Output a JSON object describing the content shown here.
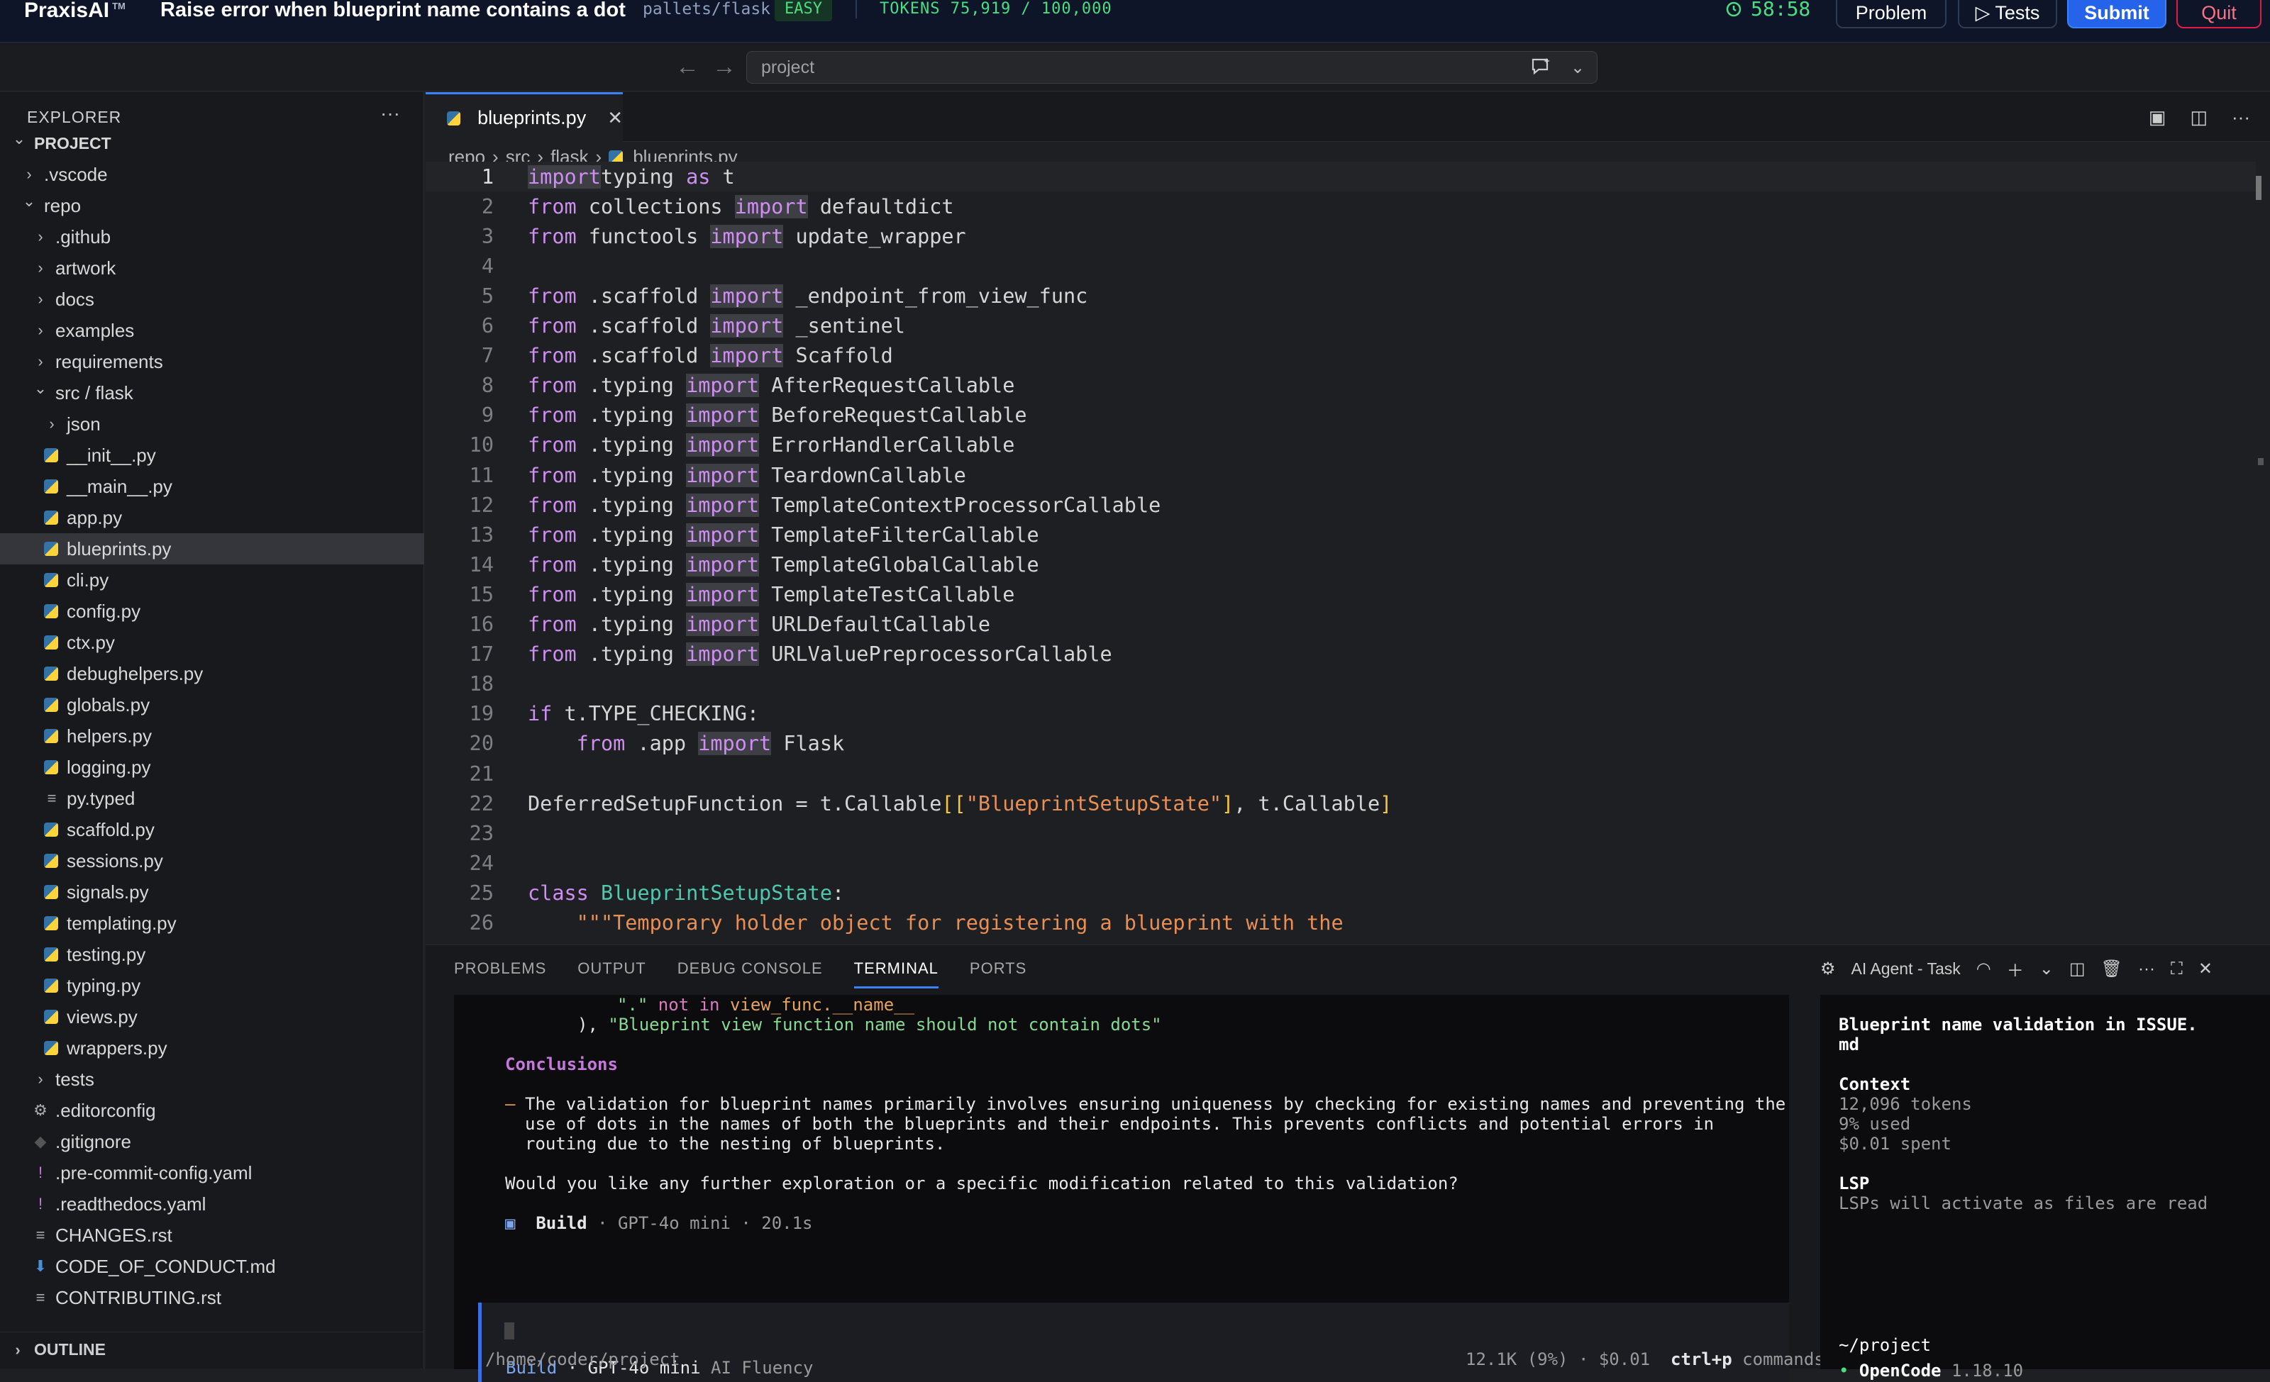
{
  "topbar": {
    "brand": "PraxisAI",
    "brand_tm": "TM",
    "task_title": "Raise error when blueprint name contains a dot",
    "repo": "pallets/flask",
    "difficulty": "EASY",
    "tokens": "TOKENS 75,919 / 100,000",
    "timer": "58:58",
    "problem_label": "Problem",
    "tests_label": "▷ Tests",
    "submit_label": "Submit",
    "quit_label": "Quit"
  },
  "command_bar": {
    "placeholder": "project"
  },
  "sidebar": {
    "title": "EXPLORER",
    "items": [
      {
        "label": "PROJECT",
        "kind": "root",
        "depth": 0,
        "open": true
      },
      {
        "label": ".vscode",
        "kind": "folder",
        "depth": 1,
        "open": false
      },
      {
        "label": "repo",
        "kind": "folder",
        "depth": 1,
        "open": true
      },
      {
        "label": ".github",
        "kind": "folder",
        "depth": 2,
        "open": false
      },
      {
        "label": "artwork",
        "kind": "folder",
        "depth": 2,
        "open": false
      },
      {
        "label": "docs",
        "kind": "folder",
        "depth": 2,
        "open": false
      },
      {
        "label": "examples",
        "kind": "folder",
        "depth": 2,
        "open": false
      },
      {
        "label": "requirements",
        "kind": "folder",
        "depth": 2,
        "open": false
      },
      {
        "label": "src / flask",
        "kind": "folder",
        "depth": 2,
        "open": true
      },
      {
        "label": "json",
        "kind": "folder",
        "depth": 3,
        "open": false
      },
      {
        "label": "__init__.py",
        "kind": "py",
        "depth": 3
      },
      {
        "label": "__main__.py",
        "kind": "py",
        "depth": 3
      },
      {
        "label": "app.py",
        "kind": "py",
        "depth": 3
      },
      {
        "label": "blueprints.py",
        "kind": "py",
        "depth": 3,
        "active": true
      },
      {
        "label": "cli.py",
        "kind": "py",
        "depth": 3
      },
      {
        "label": "config.py",
        "kind": "py",
        "depth": 3
      },
      {
        "label": "ctx.py",
        "kind": "py",
        "depth": 3
      },
      {
        "label": "debughelpers.py",
        "kind": "py",
        "depth": 3
      },
      {
        "label": "globals.py",
        "kind": "py",
        "depth": 3
      },
      {
        "label": "helpers.py",
        "kind": "py",
        "depth": 3
      },
      {
        "label": "logging.py",
        "kind": "py",
        "depth": 3
      },
      {
        "label": "py.typed",
        "kind": "text",
        "depth": 3
      },
      {
        "label": "scaffold.py",
        "kind": "py",
        "depth": 3
      },
      {
        "label": "sessions.py",
        "kind": "py",
        "depth": 3
      },
      {
        "label": "signals.py",
        "kind": "py",
        "depth": 3
      },
      {
        "label": "templating.py",
        "kind": "py",
        "depth": 3
      },
      {
        "label": "testing.py",
        "kind": "py",
        "depth": 3
      },
      {
        "label": "typing.py",
        "kind": "py",
        "depth": 3
      },
      {
        "label": "views.py",
        "kind": "py",
        "depth": 3
      },
      {
        "label": "wrappers.py",
        "kind": "py",
        "depth": 3
      },
      {
        "label": "tests",
        "kind": "folder",
        "depth": 2,
        "open": false
      },
      {
        "label": ".editorconfig",
        "kind": "gear",
        "depth": 2
      },
      {
        "label": ".gitignore",
        "kind": "git",
        "depth": 2
      },
      {
        "label": ".pre-commit-config.yaml",
        "kind": "yaml",
        "depth": 2
      },
      {
        "label": ".readthedocs.yaml",
        "kind": "yaml",
        "depth": 2
      },
      {
        "label": "CHANGES.rst",
        "kind": "text",
        "depth": 2
      },
      {
        "label": "CODE_OF_CONDUCT.md",
        "kind": "md",
        "depth": 2
      },
      {
        "label": "CONTRIBUTING.rst",
        "kind": "text",
        "depth": 2
      }
    ],
    "outline_label": "OUTLINE"
  },
  "editor": {
    "tab_label": "blueprints.py",
    "breadcrumb": [
      "repo",
      "src",
      "flask",
      "blueprints.py"
    ],
    "current_line": 1,
    "lines": [
      [
        [
          "kwi",
          "import"
        ],
        [
          "",
          "typing "
        ],
        [
          "kw",
          "as"
        ],
        [
          "",
          " t"
        ]
      ],
      [
        [
          "kw",
          "from"
        ],
        [
          "",
          " collections "
        ],
        [
          "kwi",
          "import"
        ],
        [
          "",
          " defaultdict"
        ]
      ],
      [
        [
          "kw",
          "from"
        ],
        [
          "",
          " functools "
        ],
        [
          "kwi",
          "import"
        ],
        [
          "",
          " update_wrapper"
        ]
      ],
      [],
      [
        [
          "kw",
          "from"
        ],
        [
          "",
          " .scaffold "
        ],
        [
          "kwi",
          "import"
        ],
        [
          "",
          " _endpoint_from_view_func"
        ]
      ],
      [
        [
          "kw",
          "from"
        ],
        [
          "",
          " .scaffold "
        ],
        [
          "kwi",
          "import"
        ],
        [
          "",
          " _sentinel"
        ]
      ],
      [
        [
          "kw",
          "from"
        ],
        [
          "",
          " .scaffold "
        ],
        [
          "kwi",
          "import"
        ],
        [
          "",
          " Scaffold"
        ]
      ],
      [
        [
          "kw",
          "from"
        ],
        [
          "",
          " .typing "
        ],
        [
          "kwi",
          "import"
        ],
        [
          "",
          " AfterRequestCallable"
        ]
      ],
      [
        [
          "kw",
          "from"
        ],
        [
          "",
          " .typing "
        ],
        [
          "kwi",
          "import"
        ],
        [
          "",
          " BeforeRequestCallable"
        ]
      ],
      [
        [
          "kw",
          "from"
        ],
        [
          "",
          " .typing "
        ],
        [
          "kwi",
          "import"
        ],
        [
          "",
          " ErrorHandlerCallable"
        ]
      ],
      [
        [
          "kw",
          "from"
        ],
        [
          "",
          " .typing "
        ],
        [
          "kwi",
          "import"
        ],
        [
          "",
          " TeardownCallable"
        ]
      ],
      [
        [
          "kw",
          "from"
        ],
        [
          "",
          " .typing "
        ],
        [
          "kwi",
          "import"
        ],
        [
          "",
          " TemplateContextProcessorCallable"
        ]
      ],
      [
        [
          "kw",
          "from"
        ],
        [
          "",
          " .typing "
        ],
        [
          "kwi",
          "import"
        ],
        [
          "",
          " TemplateFilterCallable"
        ]
      ],
      [
        [
          "kw",
          "from"
        ],
        [
          "",
          " .typing "
        ],
        [
          "kwi",
          "import"
        ],
        [
          "",
          " TemplateGlobalCallable"
        ]
      ],
      [
        [
          "kw",
          "from"
        ],
        [
          "",
          " .typing "
        ],
        [
          "kwi",
          "import"
        ],
        [
          "",
          " TemplateTestCallable"
        ]
      ],
      [
        [
          "kw",
          "from"
        ],
        [
          "",
          " .typing "
        ],
        [
          "kwi",
          "import"
        ],
        [
          "",
          " URLDefaultCallable"
        ]
      ],
      [
        [
          "kw",
          "from"
        ],
        [
          "",
          " .typing "
        ],
        [
          "kwi",
          "import"
        ],
        [
          "",
          " URLValuePreprocessorCallable"
        ]
      ],
      [],
      [
        [
          "kw",
          "if"
        ],
        [
          "",
          " t.TYPE_CHECKING:"
        ]
      ],
      [
        [
          "",
          "    "
        ],
        [
          "kw",
          "from"
        ],
        [
          "",
          " .app "
        ],
        [
          "kwi",
          "import"
        ],
        [
          "",
          " Flask"
        ]
      ],
      [],
      [
        [
          "",
          "DeferredSetupFunction = t.Callable"
        ],
        [
          "brk",
          "[["
        ],
        [
          "str",
          "\"BlueprintSetupState\""
        ],
        [
          "brk",
          "]"
        ],
        [
          "",
          ", t.Callable"
        ],
        [
          "brk",
          "]"
        ]
      ],
      [],
      [],
      [
        [
          "kw",
          "class"
        ],
        [
          "",
          " "
        ],
        [
          "cls",
          "BlueprintSetupState"
        ],
        [
          "",
          ":"
        ]
      ],
      [
        [
          "",
          "    "
        ],
        [
          "str",
          "\"\"\"Temporary holder object for registering a blueprint with the"
        ]
      ]
    ]
  },
  "panel": {
    "tabs": [
      "PROBLEMS",
      "OUTPUT",
      "DEBUG CONSOLE",
      "TERMINAL",
      "PORTS"
    ],
    "active_tab": "TERMINAL",
    "terminal_name": "AI Agent - Task"
  },
  "terminal": {
    "code_line1_a": "\".\"",
    "code_line1_b": " not in ",
    "code_line1_c": "view_func.__name__",
    "code_line2_a": "), ",
    "code_line2_b": "\"Blueprint view function name should not contain dots\"",
    "conclusions_heading": "Conclusions",
    "bullet_dash": "–",
    "bullet_l1": "The validation for blueprint names primarily involves ensuring uniqueness by checking for existing names and preventing the",
    "bullet_l2": "use of dots in the names of both the blueprints and their endpoints. This prevents conflicts and potential errors in",
    "bullet_l3": "routing due to the nesting of blueprints.",
    "question": "Would you like any further exploration or a specific modification related to this validation?",
    "status_icon": "▣",
    "status_mode": "Build",
    "status_meta": "· GPT-4o mini · 20.1s",
    "input_mode": "Build",
    "input_model": "· GPT-4o mini",
    "input_extra": "AI Fluency",
    "footer_path": "/home/coder/project",
    "footer_usage": "12.1K (9%) · $0.01",
    "footer_key": "ctrl+p",
    "footer_cmd": "commands"
  },
  "side_panel": {
    "title_l1": "Blueprint name validation in ISSUE.",
    "title_l2": "md",
    "context_label": "Context",
    "tokens": "12,096 tokens",
    "used": "9% used",
    "spent": "$0.01 spent",
    "lsp_label": "LSP",
    "lsp_note": "LSPs will activate as files are read",
    "cwd": "~/project",
    "app_name": "OpenCode",
    "app_version": "1.18.10"
  },
  "colors": {
    "accent": "#3b82f6",
    "keyword": "#cf8ef2",
    "string": "#e88f56",
    "class": "#4ec9b0",
    "timer": "#4ade80"
  }
}
